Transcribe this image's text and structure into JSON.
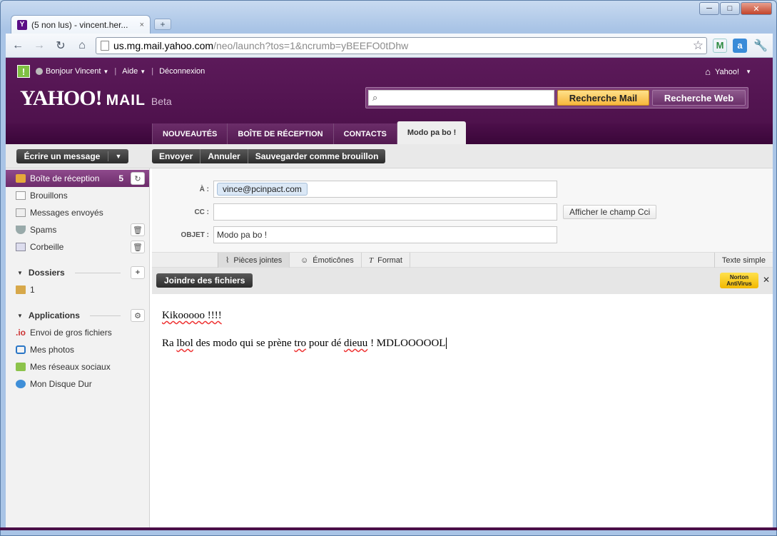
{
  "browser": {
    "tab_title": "(5 non lus) - vincent.her...",
    "tab_close": "×",
    "new_tab": "+",
    "url_host": "us.mg.mail.yahoo.com",
    "url_path": "/neo/launch?tos=1&ncrumb=yBEEFO0tDhw",
    "win_minimize": "─",
    "win_maximize": "□",
    "win_close": "✕"
  },
  "header": {
    "greeting": "Bonjour Vincent",
    "help": "Aide",
    "logout": "Déconnexion",
    "yahoo_home": "Yahoo!",
    "logo_yahoo": "YAHOO!",
    "logo_mail": "MAIL",
    "logo_beta": "Beta",
    "search_placeholder": "",
    "search_mail": "Recherche Mail",
    "search_web": "Recherche Web"
  },
  "tabs": [
    {
      "label": "NOUVEAUTÉS"
    },
    {
      "label": "BOÎTE DE RÉCEPTION"
    },
    {
      "label": "CONTACTS"
    },
    {
      "label": "Modo pa bo !"
    }
  ],
  "actions": {
    "compose": "Écrire un message",
    "send": "Envoyer",
    "cancel": "Annuler",
    "save_draft": "Sauvegarder comme brouillon"
  },
  "sidebar": {
    "folders": [
      {
        "label": "Boîte de réception",
        "count": "5"
      },
      {
        "label": "Brouillons"
      },
      {
        "label": "Messages envoyés"
      },
      {
        "label": "Spams"
      },
      {
        "label": "Corbeille"
      }
    ],
    "dossiers_title": "Dossiers",
    "custom_folders": [
      {
        "label": "1"
      }
    ],
    "applications_title": "Applications",
    "apps": [
      {
        "label": "Envoi de gros fichiers",
        "icon_text": ".io"
      },
      {
        "label": "Mes photos"
      },
      {
        "label": "Mes réseaux sociaux"
      },
      {
        "label": "Mon Disque Dur"
      }
    ]
  },
  "compose": {
    "to_label": "À :",
    "to_value": "vince@pcinpact.com",
    "cc_label": "CC :",
    "cc_value": "",
    "show_cci": "Afficher le champ Cci",
    "subject_label": "OBJET :",
    "subject_value": "Modo pa bo !",
    "rte": {
      "attachments": "Pièces jointes",
      "emoticons": "Émoticônes",
      "format": "Format",
      "plain_text": "Texte simple"
    },
    "attach_files": "Joindre des fichiers",
    "norton_line1": "Norton",
    "norton_line2": "AntiVirus",
    "body_line1": "Kikooooo !!!!",
    "body_line2_a": "Ra ",
    "body_line2_b": "lbol",
    "body_line2_c": " des modo qui se prène ",
    "body_line2_d": "tro",
    "body_line2_e": " pour dé ",
    "body_line2_f": "dieuu",
    "body_line2_g": " ! MDLOOOOOL"
  },
  "colors": {
    "brand_purple": "#5c1a5a",
    "search_mail_orange": "#f6b73c",
    "active_folder": "#7d3a7b"
  }
}
